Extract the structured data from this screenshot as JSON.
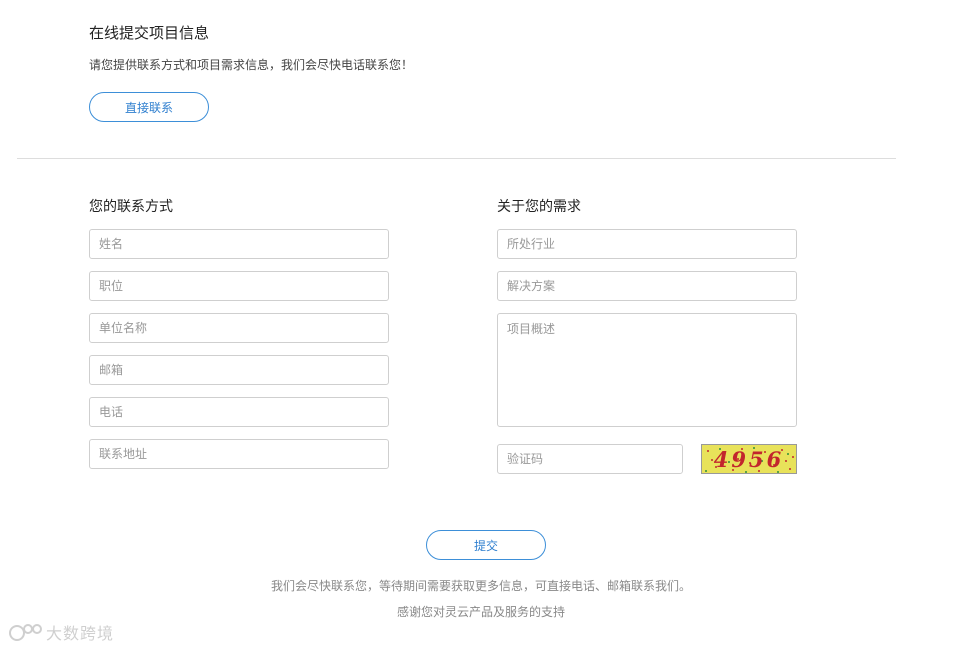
{
  "header": {
    "title": "在线提交项目信息",
    "subtitle": "请您提供联系方式和项目需求信息，我们会尽快电话联系您！",
    "direct_contact_label": "直接联系"
  },
  "contact_section": {
    "title": "您的联系方式",
    "fields": {
      "name": "姓名",
      "position": "职位",
      "company": "单位名称",
      "email": "邮箱",
      "phone": "电话",
      "address": "联系地址"
    }
  },
  "needs_section": {
    "title": "关于您的需求",
    "fields": {
      "industry": "所处行业",
      "solution": "解决方案",
      "overview": "项目概述",
      "captcha_input": "验证码"
    },
    "captcha_code": "4956"
  },
  "submit_label": "提交",
  "footer": {
    "note1": "我们会尽快联系您，等待期间需要获取更多信息，可直接电话、邮箱联系我们。",
    "note2": "感谢您对灵云产品及服务的支持"
  },
  "watermark": {
    "text": "大数跨境"
  },
  "colors": {
    "accent": "#3d8fd8",
    "captcha_bg": "#e8e25a",
    "captcha_text": "#c2262d"
  }
}
